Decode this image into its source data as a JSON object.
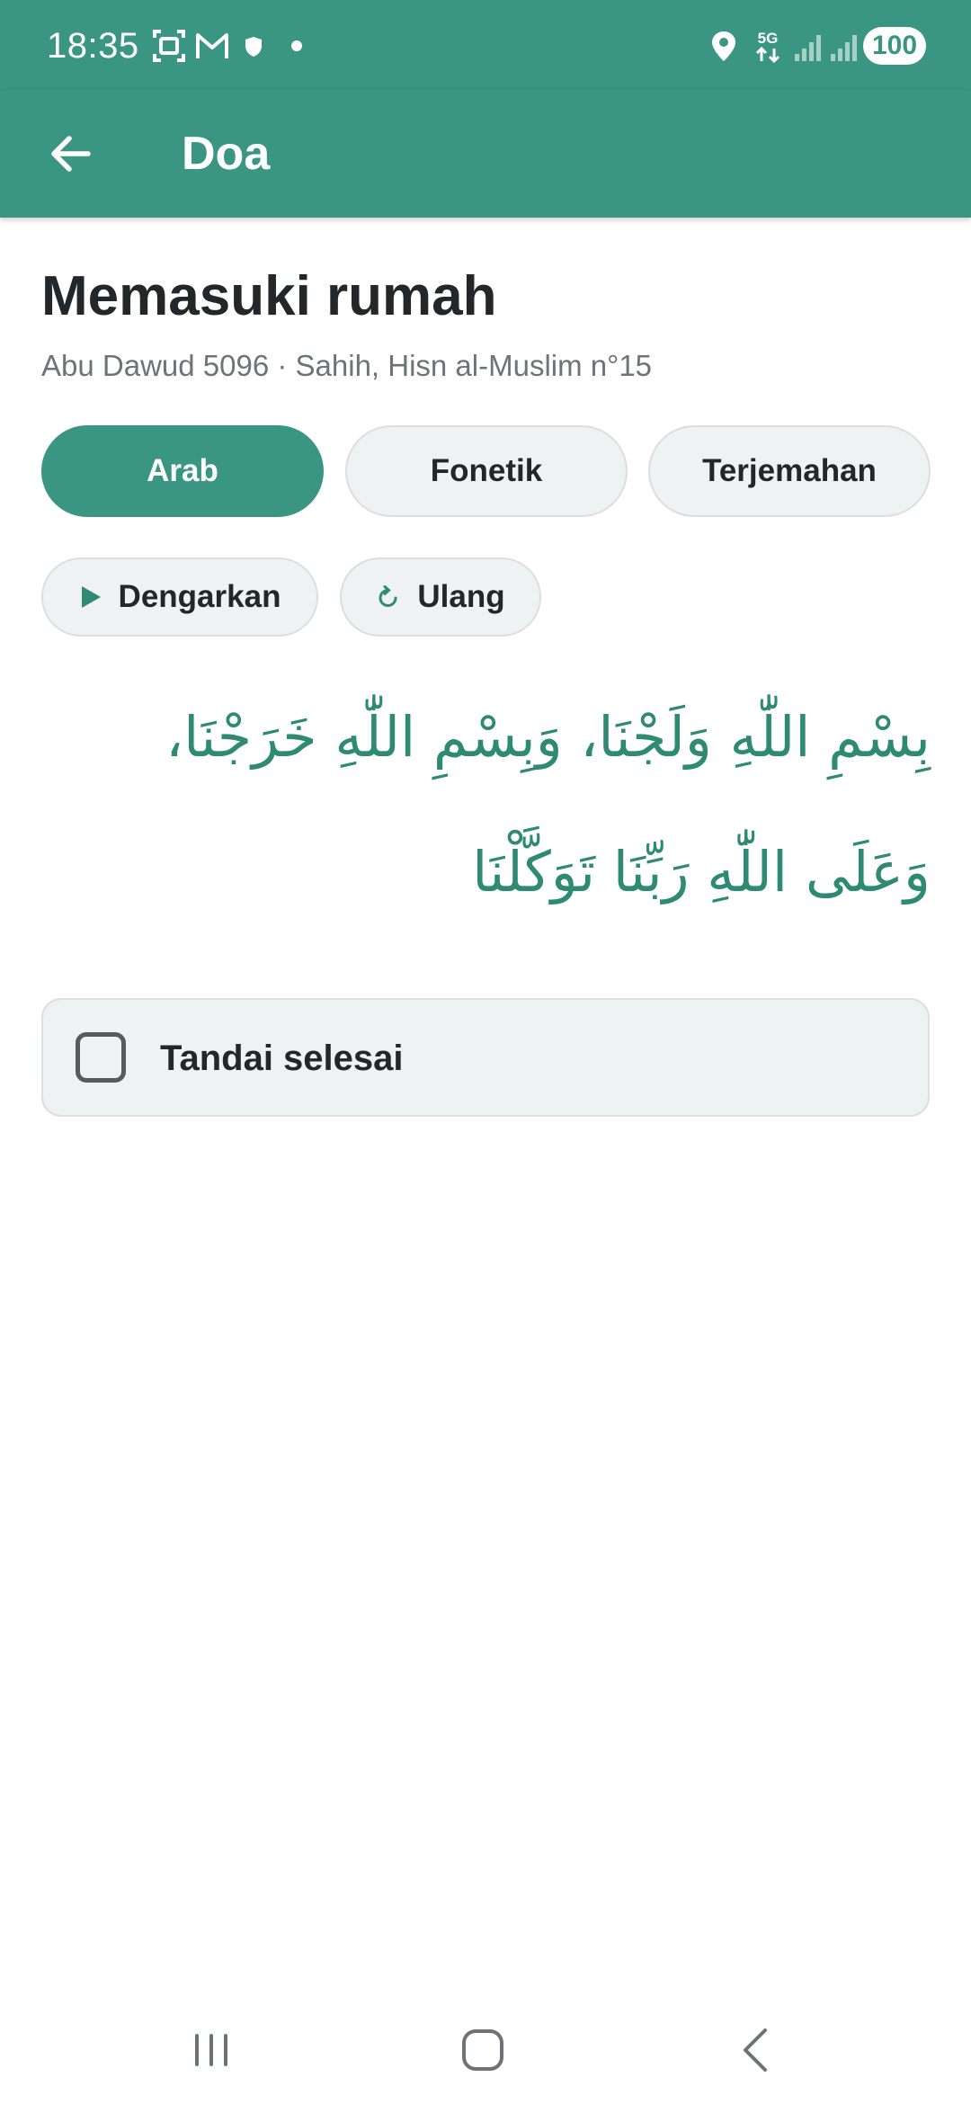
{
  "status_bar": {
    "time": "18:35",
    "battery": "100",
    "network": "5G",
    "icons": [
      "screenshot-icon",
      "gmail-icon",
      "shield-icon",
      "dot-icon",
      "location-icon",
      "network-5g-icon",
      "signal-icon",
      "signal-icon",
      "battery-icon"
    ]
  },
  "app_bar": {
    "title": "Doa",
    "back_icon": "arrow-left-icon"
  },
  "prayer": {
    "title": "Memasuki rumah",
    "source": "Abu Dawud 5096 · Sahih, Hisn al-Muslim n°15",
    "arabic": "بِسْمِ اللّٰهِ وَلَجْنَا، وَبِسْمِ اللّٰهِ خَرَجْنَا، وَعَلَى اللّٰهِ رَبِّنَا تَوَكَّلْنَا"
  },
  "tabs": [
    {
      "label": "Arab",
      "active": true
    },
    {
      "label": "Fonetik",
      "active": false
    },
    {
      "label": "Terjemahan",
      "active": false
    }
  ],
  "actions": {
    "listen_label": "Dengarkan",
    "listen_icon": "play-icon",
    "repeat_label": "Ulang",
    "repeat_icon": "repeat-icon"
  },
  "complete": {
    "label": "Tandai selesai",
    "checked": false
  },
  "nav_bar": {
    "icons": [
      "recent-apps-icon",
      "home-icon",
      "back-icon"
    ]
  },
  "colors": {
    "primary": "#3a9683",
    "arabic_text": "#2e8a72",
    "chip_background": "#eff2f2",
    "chip_border": "#dadfdf",
    "secondary_text": "#6e7377"
  }
}
